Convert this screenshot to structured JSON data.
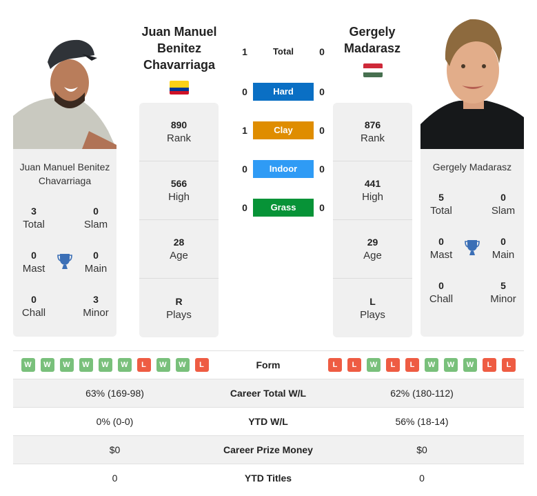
{
  "player1": {
    "name": "Juan Manuel Benitez Chavarriaga",
    "name_lines": [
      "Juan Manuel",
      "Benitez",
      "Chavarriaga"
    ],
    "card_name_lines": [
      "Juan Manuel Benitez",
      "Chavarriaga"
    ],
    "country_flag": "colombia-flag",
    "flag_colors": [
      "#fcd116",
      "#003893",
      "#ce1126"
    ],
    "stats": [
      {
        "value": "890",
        "label": "Rank"
      },
      {
        "value": "566",
        "label": "High"
      },
      {
        "value": "28",
        "label": "Age"
      },
      {
        "value": "R",
        "label": "Plays"
      }
    ],
    "titles": {
      "total": {
        "value": "3",
        "label": "Total"
      },
      "slam": {
        "value": "0",
        "label": "Slam"
      },
      "mast": {
        "value": "0",
        "label": "Mast"
      },
      "main": {
        "value": "0",
        "label": "Main"
      },
      "chall": {
        "value": "0",
        "label": "Chall"
      },
      "minor": {
        "value": "3",
        "label": "Minor"
      }
    },
    "form": [
      "W",
      "W",
      "W",
      "W",
      "W",
      "W",
      "L",
      "W",
      "W",
      "L"
    ]
  },
  "player2": {
    "name": "Gergely Madarasz",
    "name_lines": [
      "Gergely",
      "Madarasz"
    ],
    "card_name_lines": [
      "Gergely Madarasz"
    ],
    "country_flag": "hungary-flag",
    "flag_colors": [
      "#ce2939",
      "#ffffff",
      "#477050"
    ],
    "stats": [
      {
        "value": "876",
        "label": "Rank"
      },
      {
        "value": "441",
        "label": "High"
      },
      {
        "value": "29",
        "label": "Age"
      },
      {
        "value": "L",
        "label": "Plays"
      }
    ],
    "titles": {
      "total": {
        "value": "5",
        "label": "Total"
      },
      "slam": {
        "value": "0",
        "label": "Slam"
      },
      "mast": {
        "value": "0",
        "label": "Mast"
      },
      "main": {
        "value": "0",
        "label": "Main"
      },
      "chall": {
        "value": "0",
        "label": "Chall"
      },
      "minor": {
        "value": "5",
        "label": "Minor"
      }
    },
    "form": [
      "L",
      "L",
      "W",
      "L",
      "L",
      "W",
      "W",
      "W",
      "L",
      "L"
    ]
  },
  "h2h": [
    {
      "label": "Total",
      "p1": "1",
      "p2": "0",
      "color": ""
    },
    {
      "label": "Hard",
      "p1": "0",
      "p2": "0",
      "color": "#0a6fc4"
    },
    {
      "label": "Clay",
      "p1": "1",
      "p2": "0",
      "color": "#df8d00"
    },
    {
      "label": "Indoor",
      "p1": "0",
      "p2": "0",
      "color": "#2f9bf5"
    },
    {
      "label": "Grass",
      "p1": "0",
      "p2": "0",
      "color": "#079337"
    }
  ],
  "table": {
    "form_label": "Form",
    "rows": [
      {
        "label": "Career Total W/L",
        "p1": "63% (169-98)",
        "p2": "62% (180-112)"
      },
      {
        "label": "YTD W/L",
        "p1": "0% (0-0)",
        "p2": "56% (18-14)"
      },
      {
        "label": "Career Prize Money",
        "p1": "$0",
        "p2": "$0"
      },
      {
        "label": "YTD Titles",
        "p1": "0",
        "p2": "0"
      }
    ]
  },
  "colors": {
    "win": "#79c07b",
    "loss": "#ee5c43",
    "trophy": "#3b6fb6",
    "card_bg": "#f0f0f0"
  }
}
